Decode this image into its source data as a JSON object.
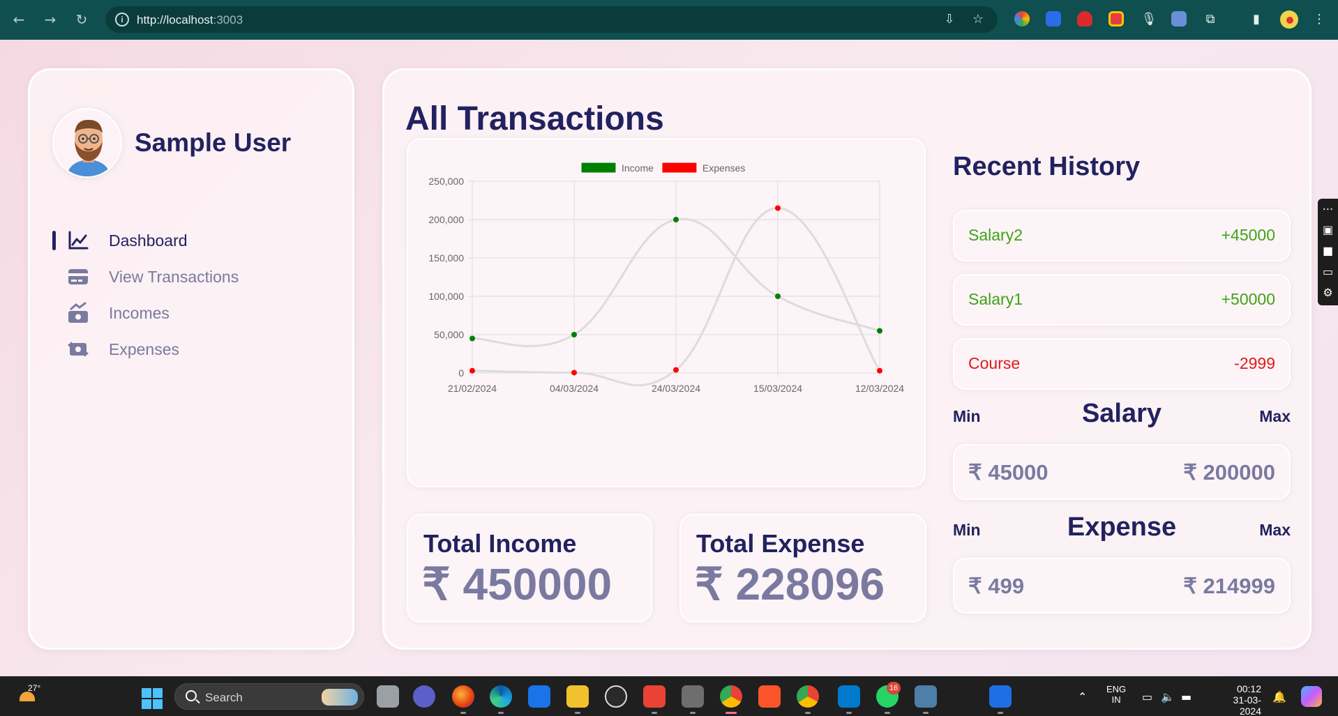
{
  "browser": {
    "url_host": "http://localhost",
    "url_port": ":3003"
  },
  "sidebar": {
    "user_name": "Sample User",
    "items": [
      {
        "label": "Dashboard",
        "icon": "chart-line-icon",
        "active": true
      },
      {
        "label": "View Transactions",
        "icon": "credit-card-icon",
        "active": false
      },
      {
        "label": "Incomes",
        "icon": "money-bill-trend-up-icon",
        "active": false
      },
      {
        "label": "Expenses",
        "icon": "money-bill-transfer-icon",
        "active": false
      }
    ]
  },
  "main": {
    "title": "All Transactions",
    "total_income_label": "Total Income",
    "total_income_value": "₹ 450000",
    "total_expense_label": "Total Expense",
    "total_expense_value": "₹ 228096"
  },
  "history": {
    "title": "Recent History",
    "items": [
      {
        "name": "Salary2",
        "amount": "+45000",
        "color": "#3fa316"
      },
      {
        "name": "Salary1",
        "amount": "+50000",
        "color": "#3fa316"
      },
      {
        "name": "Course",
        "amount": "-2999",
        "color": "#e01919"
      }
    ]
  },
  "salary_range": {
    "title": "Salary",
    "min_label": "Min",
    "max_label": "Max",
    "min": "₹ 45000",
    "max": "₹ 200000"
  },
  "expense_range": {
    "title": "Expense",
    "min_label": "Min",
    "max_label": "Max",
    "min": "₹ 499",
    "max": "₹ 214999"
  },
  "chart_data": {
    "type": "line",
    "categories": [
      "21/02/2024",
      "04/03/2024",
      "24/03/2024",
      "15/03/2024",
      "12/03/2024"
    ],
    "series": [
      {
        "name": "Income",
        "color": "#008000",
        "values": [
          45000,
          50000,
          200000,
          100000,
          55000
        ]
      },
      {
        "name": "Expenses",
        "color": "#ff0000",
        "values": [
          3000,
          499,
          4000,
          214999,
          2999
        ]
      }
    ],
    "yticks": [
      "0",
      "50,000",
      "100,000",
      "150,000",
      "200,000",
      "250,000"
    ],
    "ylim": [
      0,
      250000
    ],
    "grid": true,
    "legend": "top",
    "line_color": "#dcdcdc"
  },
  "taskbar": {
    "temperature": "27°",
    "search_placeholder": "Search",
    "lang_line1": "ENG",
    "lang_line2": "IN",
    "time": "00:12",
    "date": "31-03-2024",
    "whatsapp_badge": "16"
  }
}
